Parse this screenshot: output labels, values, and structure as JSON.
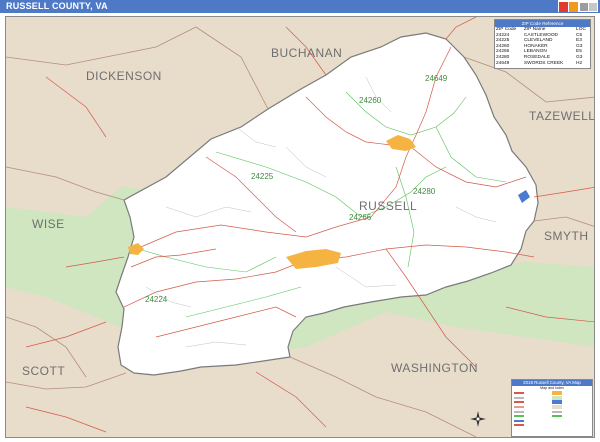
{
  "map": {
    "title": "RUSSELL COUNTY, VA",
    "main_county": "RUSSELL",
    "neighbor_counties": {
      "dickenson": "DICKENSON",
      "buchanan": "BUCHANAN",
      "tazewell": "TAZEWELL",
      "wise": "WISE",
      "smyth": "SMYTH",
      "scott": "SCOTT",
      "washington": "WASHINGTON"
    },
    "zip_labels": {
      "z24649": "24649",
      "z24260": "24260",
      "z24225": "24225",
      "z24280": "24280",
      "z24266": "24266",
      "z24224": "24224"
    },
    "colors": {
      "header": "#4d79c6",
      "neighbor_fill": "#e8dccb",
      "forest_fill": "#cfe6c0",
      "county_fill": "#ffffff",
      "road": "#d45a4a",
      "zip_boundary": "#58c158",
      "city_fill": "#f5b342",
      "water": "#4a7bd1"
    }
  },
  "zip_table": {
    "title": "ZIP Code Reference",
    "headers": {
      "zip": "ZIP Code",
      "name": "ZIP Name",
      "loc": "LOC"
    },
    "rows": [
      {
        "zip": "24224",
        "name": "CASTLEWOOD",
        "loc": "C5"
      },
      {
        "zip": "24225",
        "name": "CLEVELAND",
        "loc": "E3"
      },
      {
        "zip": "24260",
        "name": "HONAKER",
        "loc": "G3"
      },
      {
        "zip": "24266",
        "name": "LEBANON",
        "loc": "E5"
      },
      {
        "zip": "24280",
        "name": "ROSEDALE",
        "loc": "G3"
      },
      {
        "zip": "24649",
        "name": "SWORDS CREEK",
        "loc": "H2"
      }
    ]
  },
  "legend": {
    "title": "2018 Russell County, VA Map",
    "subtitle": "Map and Index",
    "left_items": [
      "",
      "",
      "",
      "",
      "",
      "",
      "",
      ""
    ],
    "right_items": [
      "",
      "",
      "",
      "",
      "",
      ""
    ]
  }
}
